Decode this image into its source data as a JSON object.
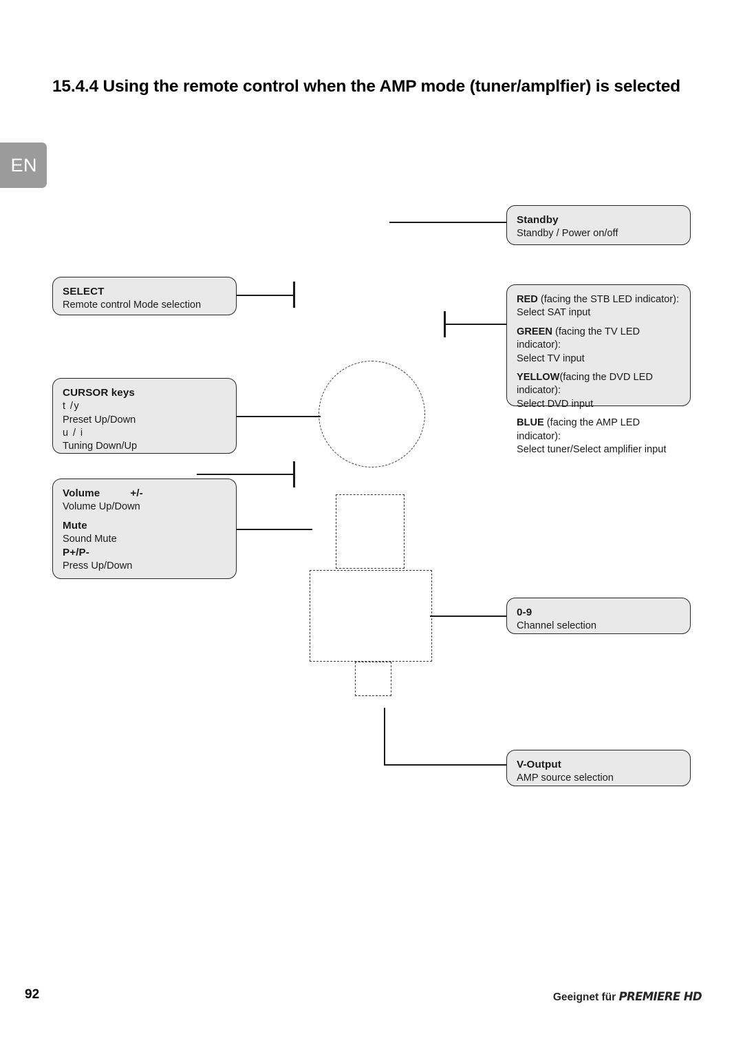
{
  "document": {
    "title": "15.4.4 Using the remote control when the AMP mode (tuner/amplfier) is selected",
    "language_tab": "EN",
    "page_number": "92",
    "footer_prefix": "Geeignet für ",
    "footer_brand": "PREMIERE HD"
  },
  "callouts": {
    "standby": {
      "heading": "Standby",
      "description": "Standby / Power on/off"
    },
    "select": {
      "heading": "SELECT",
      "description": "Remote control Mode selection"
    },
    "cursor": {
      "heading": "CURSOR keys",
      "symbols_vertical": "t  /y",
      "description_vertical": "Preset Up/Down",
      "symbols_horizontal": "u / i",
      "description_horizontal": "Tuning Down/Up"
    },
    "volume": {
      "heading": "Volume",
      "heading_suffix": "+/-",
      "description": "Volume Up/Down",
      "mute_heading": "Mute",
      "mute_description": "Sound Mute",
      "program_heading": "P+/P-",
      "program_description": "Press Up/Down"
    },
    "color_keys": {
      "lines": [
        {
          "key": "RED",
          "context": "(facing the STB LED indicator):",
          "action": "Select SAT input"
        },
        {
          "key": "GREEN",
          "context": "(facing the TV LED indicator):",
          "action": "Select TV input"
        },
        {
          "key": "YELLOW",
          "context": "(facing the DVD LED indicator):",
          "action": "Select DVD input"
        },
        {
          "key": "BLUE",
          "context": "(facing the AMP LED indicator):",
          "action": "Select tuner/Select amplifier input"
        }
      ]
    },
    "numeric": {
      "heading": "0-9",
      "description": "Channel selection"
    },
    "voutput": {
      "heading": "V-Output",
      "description": "AMP source selection"
    }
  },
  "colors": {
    "box_fill": "#e9e9e9",
    "box_border": "#262626",
    "tab_fill": "#9b9b9b",
    "line": "#1a1a1a"
  }
}
